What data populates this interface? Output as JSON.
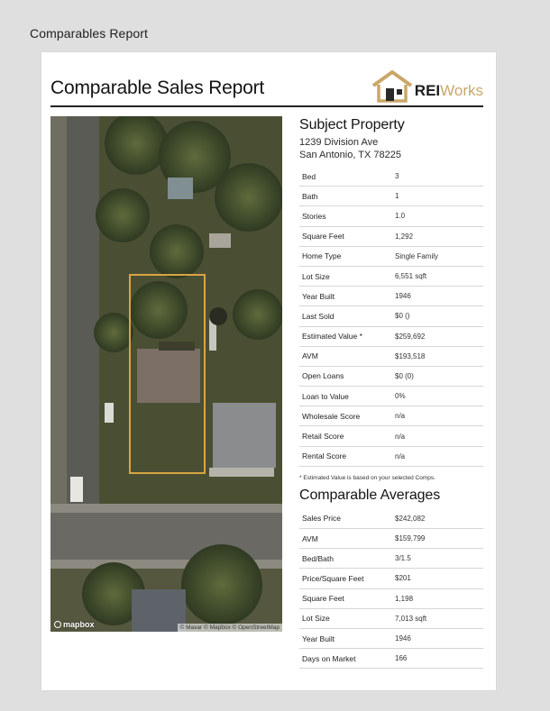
{
  "page": {
    "heading": "Comparables Report"
  },
  "report": {
    "title": "Comparable Sales Report",
    "logo": {
      "rei": "REI",
      "works": "Works",
      "accent_color": "#c9a76a"
    }
  },
  "map": {
    "brand": "mapbox",
    "attribution": "© Maxar © Mapbox © OpenStreetMap",
    "highlight_color": "#d9a441"
  },
  "subject": {
    "title": "Subject Property",
    "address_line1": "1239 Division Ave",
    "address_line2": "San Antonio, TX 78225",
    "rows": [
      {
        "label": "Bed",
        "value": "3"
      },
      {
        "label": "Bath",
        "value": "1"
      },
      {
        "label": "Stories",
        "value": "1.0"
      },
      {
        "label": "Square Feet",
        "value": "1,292"
      },
      {
        "label": "Home Type",
        "value": "Single Family"
      },
      {
        "label": "Lot Size",
        "value": "6,551 sqft"
      },
      {
        "label": "Year Built",
        "value": "1946"
      },
      {
        "label": "Last Sold",
        "value": "$0 ()"
      },
      {
        "label": "Estimated Value *",
        "value": "$259,692"
      },
      {
        "label": "AVM",
        "value": "$193,518"
      },
      {
        "label": "Open Loans",
        "value": "$0 (0)"
      },
      {
        "label": "Loan to Value",
        "value": "0%"
      },
      {
        "label": "Wholesale Score",
        "value": "n/a"
      },
      {
        "label": "Retail Score",
        "value": "n/a"
      },
      {
        "label": "Rental Score",
        "value": "n/a"
      }
    ],
    "footnote": "* Estimated Value is based on your selected Comps."
  },
  "averages": {
    "title": "Comparable Averages",
    "rows": [
      {
        "label": "Sales Price",
        "value": "$242,082"
      },
      {
        "label": "AVM",
        "value": "$159,799"
      },
      {
        "label": "Bed/Bath",
        "value": "3/1.5"
      },
      {
        "label": "Price/Square Feet",
        "value": "$201"
      },
      {
        "label": "Square Feet",
        "value": "1,198"
      },
      {
        "label": "Lot Size",
        "value": "7,013 sqft"
      },
      {
        "label": "Year Built",
        "value": "1946"
      },
      {
        "label": "Days on Market",
        "value": "166"
      }
    ]
  }
}
